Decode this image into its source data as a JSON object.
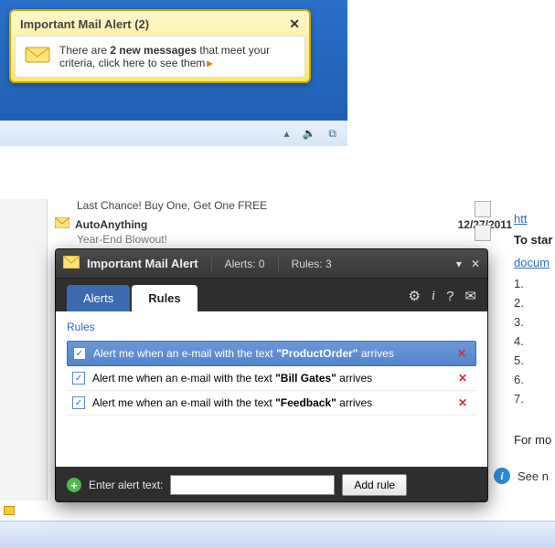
{
  "toast": {
    "title": "Important Mail Alert (2)",
    "text_prefix": "There are ",
    "text_bold": "2 new messages",
    "text_suffix": " that meet your criteria, click here to see them"
  },
  "bg": {
    "line1": "Last Chance! Buy One, Get One FREE",
    "sender": "AutoAnything",
    "date": "12/27/2011",
    "line3": "Year-End Blowout!",
    "right_link": "htt",
    "right_bold": "To star",
    "right_docum": "docum",
    "nums": [
      "1.",
      "2.",
      "3.",
      "4.",
      "5.",
      "6.",
      "7."
    ],
    "formo": "For mo",
    "see": "See n"
  },
  "panel": {
    "title": "Important Mail Alert",
    "alerts_label": "Alerts: 0",
    "rules_label": "Rules: 3",
    "tab_alerts": "Alerts",
    "tab_rules": "Rules",
    "section": "Rules",
    "rules": [
      {
        "prefix": "Alert me when an e-mail with the text ",
        "key": "\"ProductOrder\"",
        "suffix": " arrives",
        "selected": true
      },
      {
        "prefix": "Alert me when an e-mail with the text ",
        "key": "\"Bill Gates\"",
        "suffix": " arrives",
        "selected": false
      },
      {
        "prefix": "Alert me when an e-mail with the text ",
        "key": "\"Feedback\"",
        "suffix": " arrives",
        "selected": false
      }
    ],
    "footer_label": "Enter alert text:",
    "footer_button": "Add rule"
  }
}
